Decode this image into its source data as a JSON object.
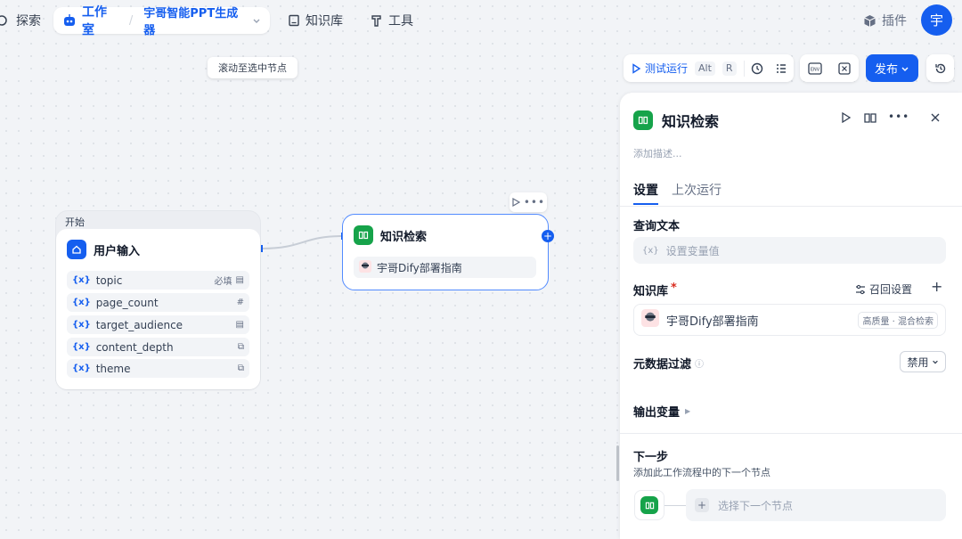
{
  "nav": {
    "explore": "探索",
    "workspace": "工作室",
    "app_name": "宇哥智能PPT生成器",
    "knowledge": "知识库",
    "tools": "工具",
    "plugins": "插件",
    "avatar_initial": "宇"
  },
  "canvas": {
    "tooltip": "滚动至选中节点"
  },
  "toolbar": {
    "test_run": "测试运行",
    "shortcut_alt": "Alt",
    "shortcut_r": "R",
    "env": "ENV",
    "publish": "发布"
  },
  "start_node": {
    "group_label": "开始",
    "title": "用户输入",
    "variables": [
      {
        "name": "topic",
        "required": "必填"
      },
      {
        "name": "page_count",
        "required": ""
      },
      {
        "name": "target_audience",
        "required": ""
      },
      {
        "name": "content_depth",
        "required": ""
      },
      {
        "name": "theme",
        "required": ""
      }
    ],
    "var_prefix": "{x}"
  },
  "knowledge_node": {
    "title": "知识检索",
    "dataset": "宇哥Dify部署指南"
  },
  "panel": {
    "title": "知识检索",
    "description_placeholder": "添加描述...",
    "tabs": [
      "设置",
      "上次运行"
    ],
    "query_label": "查询文本",
    "query_placeholder": "设置变量值",
    "kb_label": "知识库",
    "kb_required": "*",
    "recall_settings": "召回设置",
    "kb_item": "宇哥Dify部署指南",
    "kb_badge": "高质量 · 混合检索",
    "metadata_filter": "元数据过滤",
    "metadata_value": "禁用",
    "output_vars": "输出变量",
    "next_step": "下一步",
    "next_step_desc": "添加此工作流程中的下一个节点",
    "select_next": "选择下一个节点"
  },
  "colors": {
    "accent": "#155eef",
    "node_green": "#16a34a"
  }
}
